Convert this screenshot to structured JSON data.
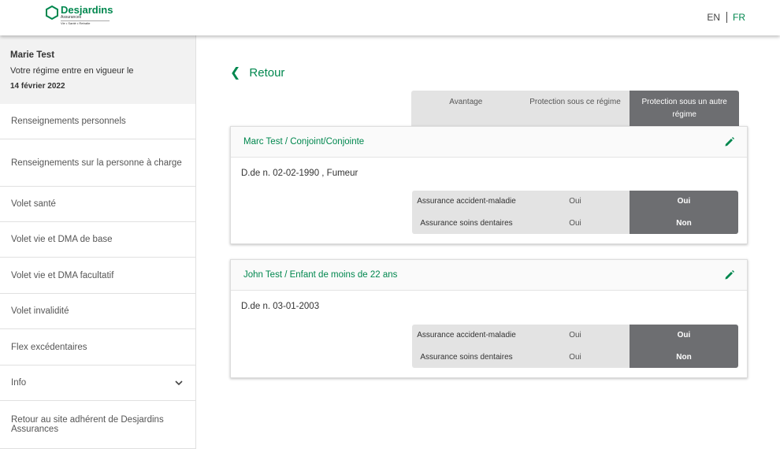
{
  "header": {
    "brand": "Desjardins",
    "brand_sub": "Assurances",
    "brand_tagline": "Vie • Santé • Retraite",
    "lang_en": "EN",
    "lang_fr": "FR",
    "brand_color": "#00874e"
  },
  "sidebar": {
    "user_name": "Marie Test",
    "regime_text": "Votre régime entre en vigueur le",
    "regime_date": "14 février 2022",
    "items": [
      {
        "label": "Renseignements personnels"
      },
      {
        "label": "Renseignements sur la personne à charge"
      },
      {
        "label": "Volet santé"
      },
      {
        "label": "Volet vie et DMA de base"
      },
      {
        "label": "Volet vie et DMA facultatif"
      },
      {
        "label": "Volet invalidité"
      },
      {
        "label": "Flex excédentaires"
      },
      {
        "label": "Info"
      },
      {
        "label": "Retour au site adhérent de Desjardins Assurances"
      }
    ]
  },
  "main": {
    "back_label": "Retour",
    "columns": [
      "Avantage",
      "Protection sous ce régime",
      "Protection sous un autre régime"
    ],
    "dependents": [
      {
        "title": "Marc Test / Conjoint/Conjointe",
        "dob": "D.de n. 02-02-1990 , Fumeur",
        "rows": [
          {
            "benefit": "Assurance accident-maladie",
            "this_plan": "Oui",
            "other_plan": "Oui"
          },
          {
            "benefit": "Assurance soins dentaires",
            "this_plan": "Oui",
            "other_plan": "Non"
          }
        ]
      },
      {
        "title": "John Test / Enfant de moins de 22 ans",
        "dob": "D.de n. 03-01-2003",
        "rows": [
          {
            "benefit": "Assurance accident-maladie",
            "this_plan": "Oui",
            "other_plan": "Oui"
          },
          {
            "benefit": "Assurance soins dentaires",
            "this_plan": "Oui",
            "other_plan": "Non"
          }
        ]
      }
    ]
  }
}
